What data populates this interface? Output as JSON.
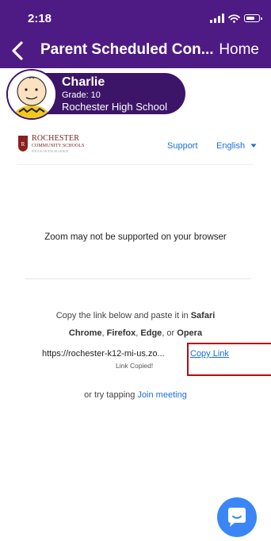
{
  "status_bar": {
    "time": "2:18"
  },
  "nav": {
    "title": "Parent Scheduled Con...",
    "home_label": "Home"
  },
  "student": {
    "name": "Charlie",
    "grade": "Grade: 10",
    "school": "Rochester High School"
  },
  "site": {
    "logo_line1": "ROCHESTER",
    "logo_line2": "COMMUNITY SCHOOLS",
    "logo_line3": "FOCUS ON EXCELLENCE",
    "support": "Support",
    "language": "English"
  },
  "content": {
    "warning": "Zoom may not be supported on your browser",
    "instr_prefix": "Copy the link below and paste it in",
    "browser_safari": "Safari",
    "browser_chrome": "Chrome",
    "browser_firefox": "Firefox",
    "browser_edge": "Edge",
    "browser_opera": "Opera",
    "sep_comma1": ",",
    "sep_comma2": ",",
    "sep_or": ", or",
    "link_url": "https://rochester-k12-mi-us.zo...",
    "copy_link": "Copy Link",
    "link_copied": "Link Copied!",
    "join_prefix": "or try tapping",
    "join_link": "Join meeting"
  },
  "colors": {
    "header_bg": "#4e1a84",
    "card_bg": "#3d1568",
    "link": "#1a6fd6",
    "highlight": "#b30d0d",
    "fab": "#3a86f7"
  },
  "icons": {
    "back": "chevron-left-icon",
    "signal": "signal-icon",
    "wifi": "wifi-icon",
    "battery": "battery-icon",
    "lang_caret": "caret-down-icon",
    "chat": "chat-icon"
  }
}
